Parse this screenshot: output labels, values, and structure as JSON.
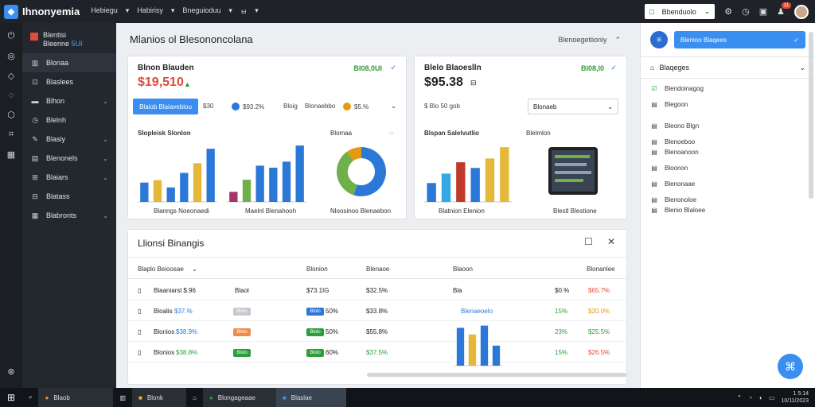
{
  "topbar": {
    "app_name": "Ihnonyemia",
    "menus": [
      "Hebiegu",
      "Habirisy",
      "Bneguioduu",
      "ㅂ"
    ],
    "search_value": "Bbenduolo",
    "notif_count": "11"
  },
  "sidebar": {
    "header_line1": "Blentisi",
    "header_line2": "Bleenne",
    "header_accent": "5UI",
    "items": [
      {
        "label": "Blonaa",
        "chev": false
      },
      {
        "label": "Blaslees",
        "chev": false
      },
      {
        "label": "Blhon",
        "chev": true
      },
      {
        "label": "Blelnh",
        "chev": false
      },
      {
        "label": "Blasiy",
        "chev": true
      },
      {
        "label": "Blenonels",
        "chev": true
      },
      {
        "label": "Blaiars",
        "chev": true
      },
      {
        "label": "Blatass",
        "chev": false
      },
      {
        "label": "Blabronts",
        "chev": true
      }
    ]
  },
  "main": {
    "breadcrumb": "Mlanios ol Blesononcolana",
    "crumb_right": "Blenoegetiioniy",
    "card1": {
      "title": "Blnon Blauden",
      "value": "$19,510",
      "delta": "BI08,0UI",
      "btn": "Blaiob Blaiavebiou",
      "chip1": "$30",
      "chip2": "$93.2%",
      "chip3": "Bloig",
      "chip4": "Blonaebbo",
      "chip5": "$5.%",
      "sub1": "Slopleisk Slonlon",
      "sub2": "Blomaa",
      "cap1": "Blanngs Noeonaedi",
      "cap2": "Maelnl Blenahooh",
      "cap3": "Nloosinoo Blenaebon"
    },
    "card2": {
      "title": "Blelo Blaoeslln",
      "value": "$95.38",
      "delta": "BI08,I0",
      "chip1": "$ Blo 50 gob",
      "select": "Blonaeb",
      "sub1": "Blspan Salelvutlio",
      "sub2": "Blelmlon",
      "cap1": "Blatnion Elenion",
      "cap2": "Blestl Blestione"
    },
    "table": {
      "title": "Llionsi Binangis",
      "headers": [
        "Blaplo Beioosae",
        "Blonion",
        "Blenaoe",
        "Blaoon",
        "Blonanlee"
      ],
      "rows": [
        {
          "c1": "Blaaniarsl $.96",
          "c2": "Blaol",
          "c3": "$73.1IG",
          "c4": "$32.5%",
          "c5": "Bla",
          "c6": "$0.%",
          "c7": "$65.7%"
        },
        {
          "c1": "Bloalis",
          "c1b": "$37.%",
          "c2": "Blolo",
          "c3": "50%",
          "c4": "$33.8%",
          "c5": "Blenaeoelo",
          "c6": "15%",
          "c7": "$20.0%"
        },
        {
          "c1": "Blonios",
          "c1b": "$38.9%",
          "c2": "Blolo",
          "c3": "50%",
          "c4": "$55.8%",
          "c6": "23%",
          "c7": "$25.5%"
        },
        {
          "c1": "Blonios",
          "c1b": "$38.8%",
          "c2": "Blolo",
          "c3": "60%",
          "c4": "$37.5%",
          "c6": "15%",
          "c7": "$26.5%"
        }
      ]
    }
  },
  "panel": {
    "button_label": "Blenioo Blaqees",
    "section": "Blaqeges",
    "items": [
      "Blendoinagog",
      "Blegoon",
      "Bleono Blgn",
      "Blenoeboo",
      "Blenoanoon",
      "Bloonon",
      "Blenonaae",
      "Blenonoloe",
      "Blenio Blaloee"
    ]
  },
  "taskbar": {
    "items": [
      "Blaob",
      "Blonk",
      "Blongageaae",
      "Blaslae"
    ],
    "time": "1 5:14",
    "date": "10/11/2023"
  },
  "colors": {
    "accent": "#3a8ef0",
    "red": "#e14b3b",
    "green": "#2e9d3b",
    "orange": "#e59a12"
  },
  "chart_data": [
    {
      "type": "bar",
      "categories": [
        "1",
        "2",
        "3",
        "4",
        "5",
        "6"
      ],
      "series": [
        {
          "name": "",
          "values": [
            40,
            45,
            30,
            60,
            80,
            110
          ]
        }
      ],
      "ylim": [
        0,
        125
      ]
    },
    {
      "type": "bar",
      "categories": [
        "1",
        "2",
        "3",
        "4",
        "5",
        "6"
      ],
      "series": [
        {
          "name": "",
          "values": [
            25,
            55,
            90,
            85,
            100,
            140
          ]
        }
      ],
      "ylim": [
        0,
        150
      ]
    },
    {
      "type": "pie",
      "values": [
        55,
        35,
        10
      ]
    },
    {
      "type": "bar",
      "categories": [
        "1",
        "2",
        "3",
        "4",
        "5",
        "6"
      ],
      "series": [
        {
          "name": "",
          "values": [
            50,
            75,
            105,
            90,
            115,
            145
          ]
        }
      ],
      "ylim": [
        0,
        160
      ]
    },
    {
      "type": "bar",
      "categories": [
        "1",
        "2",
        "3",
        "4"
      ],
      "series": [
        {
          "name": "",
          "values": [
            85,
            70,
            90,
            45
          ]
        }
      ],
      "ylim": [
        0,
        100
      ]
    }
  ]
}
